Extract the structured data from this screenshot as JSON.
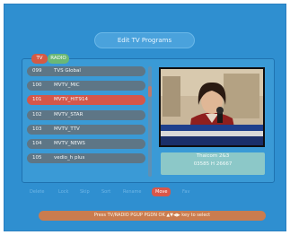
{
  "header": {
    "title": "Edit TV Programs"
  },
  "tabs": [
    {
      "label": "TV",
      "active": true
    },
    {
      "label": "RADIO",
      "active": false
    }
  ],
  "channels": [
    {
      "number": "099",
      "name": "TVS Global"
    },
    {
      "number": "100",
      "name": "MVTV_MIC"
    },
    {
      "number": "101",
      "name": "MVTV_HIT914",
      "selected": true
    },
    {
      "number": "102",
      "name": "MVTV_STAR"
    },
    {
      "number": "103",
      "name": "MVTV_TTV"
    },
    {
      "number": "104",
      "name": "MVTV_NEWS"
    },
    {
      "number": "105",
      "name": "vedio_h plus"
    }
  ],
  "preview": {
    "satellite": "Thaicom 2&3",
    "frequency": "03585 H 26667"
  },
  "functions": [
    {
      "label": "Delete",
      "active": false
    },
    {
      "label": "Lock",
      "active": false
    },
    {
      "label": "Skip",
      "active": false
    },
    {
      "label": "Sort",
      "active": false
    },
    {
      "label": "Rename",
      "active": false
    },
    {
      "label": "Move",
      "active": true
    },
    {
      "label": "Fav",
      "active": false
    }
  ],
  "hint": "Press TV/RADIO PGUP PGDN OK ▲▼◀▶ key to select",
  "colors": {
    "background": "#2f8fd0",
    "selected_row": "#d4574a",
    "row": "#5e7686",
    "hint_bar": "#ca7c4f",
    "info_box": "#8cc8c8"
  }
}
